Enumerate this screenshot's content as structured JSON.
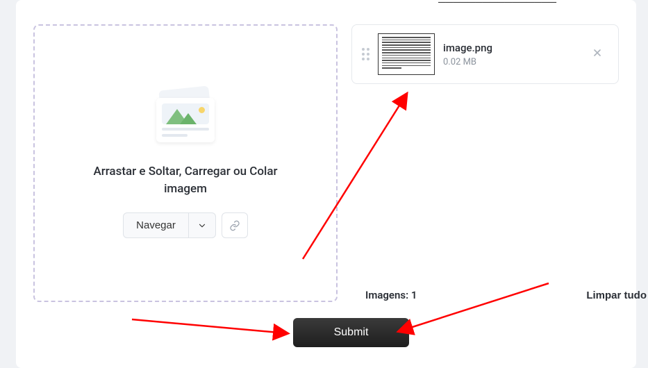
{
  "partial_header": "────────────────",
  "dropzone": {
    "instruction": "Arrastar e Soltar, Carregar ou Colar imagem",
    "browse_label": "Navegar"
  },
  "file": {
    "name": "image.png",
    "size": "0.02 MB"
  },
  "counter": {
    "label": "Imagens:",
    "value": "1"
  },
  "clear_label": "Limpar tudo",
  "submit_label": "Submit"
}
